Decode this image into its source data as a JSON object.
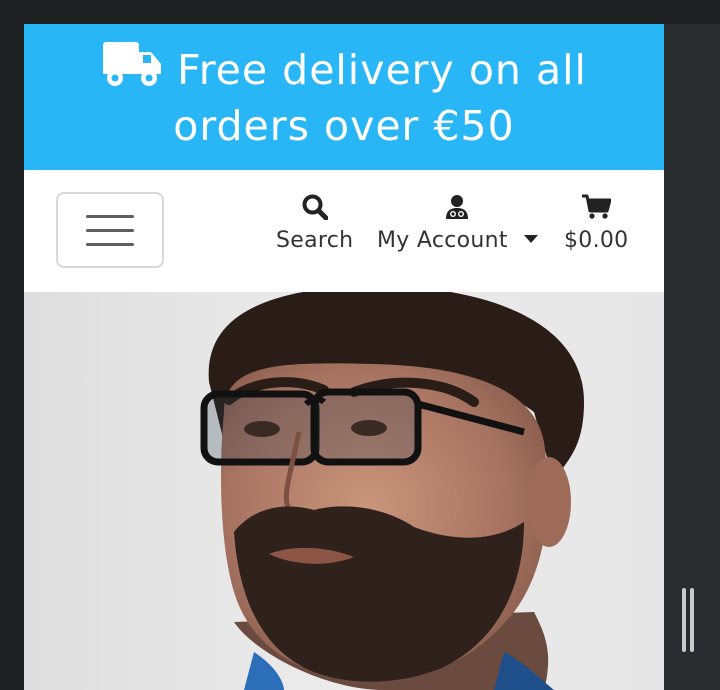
{
  "banner": {
    "text": "Free delivery on all orders over €50",
    "icon": "truck-icon",
    "background": "#29b6f6"
  },
  "navbar": {
    "toggler_icon": "hamburger-icon",
    "search_label": "Search",
    "account_label": "My Account",
    "cart_label": "$0.00",
    "icons": {
      "search": "search-icon",
      "account": "user-doctor-icon",
      "cart": "shopping-cart-icon",
      "dropdown": "caret-down-icon"
    }
  },
  "hero": {
    "image": "portrait of a bearded man wearing dark glasses"
  }
}
